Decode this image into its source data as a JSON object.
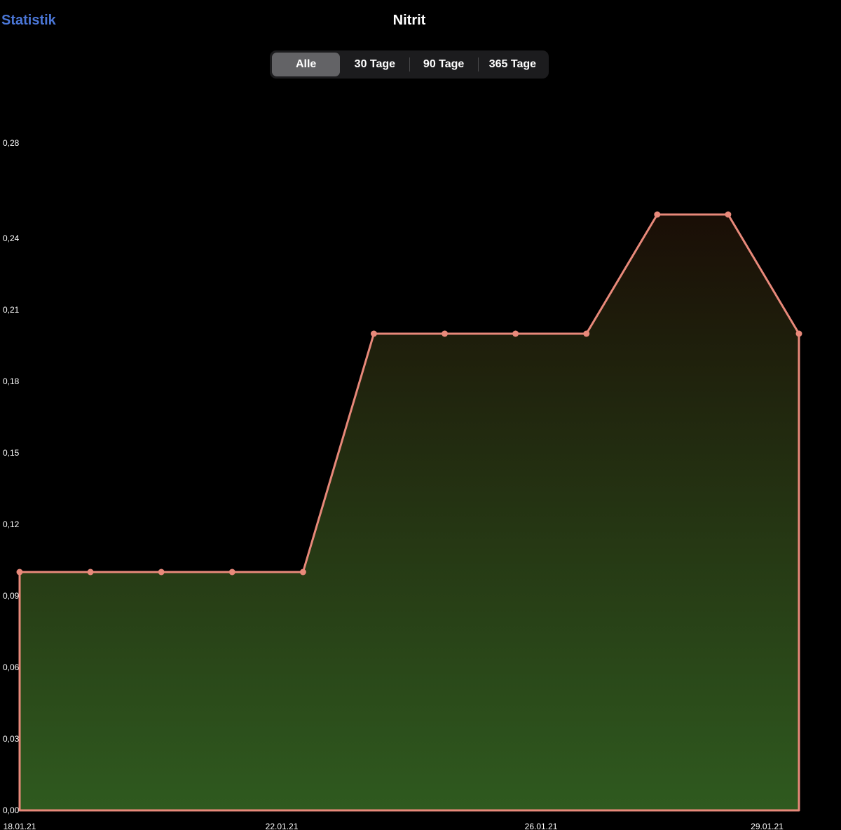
{
  "nav": {
    "back_label": "Statistik",
    "title": "Nitrit"
  },
  "segments": [
    "Alle",
    "30 Tage",
    "90 Tage",
    "365 Tage"
  ],
  "selected_segment": 0,
  "colors": {
    "back_link": "#4a76d6",
    "line": "#e8897a",
    "fill_top": "#1a0e06",
    "fill_bottom": "#2f5a1f"
  },
  "chart_data": {
    "type": "area",
    "title": "Nitrit",
    "xlabel": "",
    "ylabel": "",
    "x_tick_labels": [
      "18.01.21",
      "22.01.21",
      "26.01.21",
      "29.01.21"
    ],
    "x_tick_index": [
      0,
      3.7,
      7.36,
      10.55
    ],
    "y_ticks": [
      0.0,
      0.03,
      0.06,
      0.09,
      0.12,
      0.15,
      0.18,
      0.21,
      0.24,
      0.28
    ],
    "y_tick_labels": [
      "0,00",
      "0,03",
      "0,06",
      "0,09",
      "0,12",
      "0,15",
      "0,18",
      "0,21",
      "0,24",
      "0,28"
    ],
    "ylim": [
      0,
      0.28
    ],
    "grid": false,
    "legend": "none",
    "series": [
      {
        "values": [
          0.1,
          0.1,
          0.1,
          0.1,
          0.1,
          0.2,
          0.2,
          0.2,
          0.2,
          0.25,
          0.25,
          0.2
        ]
      }
    ]
  }
}
